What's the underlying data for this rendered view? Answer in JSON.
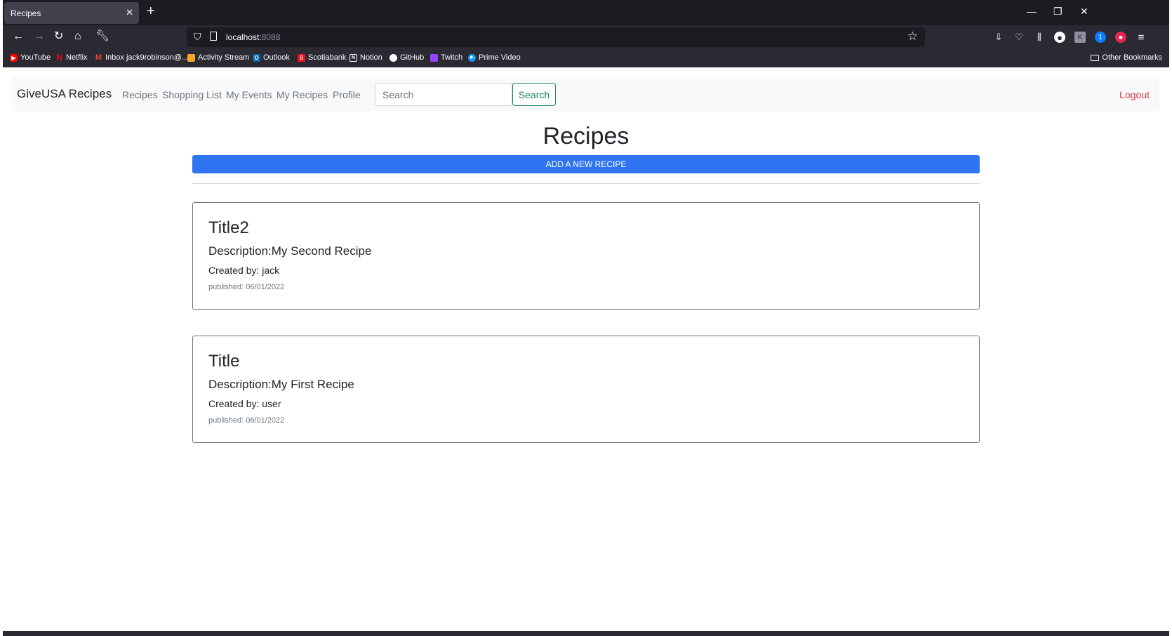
{
  "browser": {
    "tab_title": "Recipes",
    "tab_close": "✕",
    "new_tab": "+",
    "url_host": "localhost:",
    "url_port": "8088",
    "window_minimize": "—",
    "window_restore": "❐",
    "window_close": "✕",
    "bookmarks": [
      {
        "label": "YouTube",
        "icon": "youtube-icon",
        "color": "#ff0000",
        "glyph": "▶"
      },
      {
        "label": "Netflix",
        "icon": "netflix-icon",
        "color": "#e50914",
        "glyph": "N"
      },
      {
        "label": "Inbox jack9robinson@...",
        "icon": "gmail-icon",
        "color": "#ea4335",
        "glyph": "M"
      },
      {
        "label": "Activity Stream",
        "icon": "activity-stream-icon",
        "color": "#f5a623",
        "glyph": "⟋"
      },
      {
        "label": "Outlook",
        "icon": "outlook-icon",
        "color": "#0a64ad",
        "glyph": "O"
      },
      {
        "label": "Scotiabank",
        "icon": "scotiabank-icon",
        "color": "#ec111a",
        "glyph": "S"
      },
      {
        "label": "Notion",
        "icon": "notion-icon",
        "color": "#ffffff",
        "glyph": "N"
      },
      {
        "label": "GitHub",
        "icon": "github-icon",
        "color": "#ffffff",
        "glyph": "●"
      },
      {
        "label": "Twitch",
        "icon": "twitch-icon",
        "color": "#9146ff",
        "glyph": "▮"
      },
      {
        "label": "Prime Video",
        "icon": "prime-video-icon",
        "color": "#1399ff",
        "glyph": "▶"
      }
    ],
    "other_bookmarks": "Other Bookmarks"
  },
  "app": {
    "brand": "GiveUSA Recipes",
    "nav": [
      "Recipes",
      "Shopping List",
      "My Events",
      "My Recipes",
      "Profile"
    ],
    "search_placeholder": "Search",
    "search_button": "Search",
    "logout": "Logout",
    "accent_color": "#2f74f0",
    "logout_color": "#dc3545",
    "search_color": "#198754"
  },
  "page": {
    "title": "Recipes",
    "add_button": "ADD A NEW RECIPE"
  },
  "recipes": [
    {
      "title": "Title2",
      "description": "Description:My Second Recipe",
      "created_by": "Created by: jack",
      "published": "published: 06/01/2022"
    },
    {
      "title": "Title",
      "description": "Description:My First Recipe",
      "created_by": "Created by: user",
      "published": "published: 06/01/2022"
    }
  ]
}
